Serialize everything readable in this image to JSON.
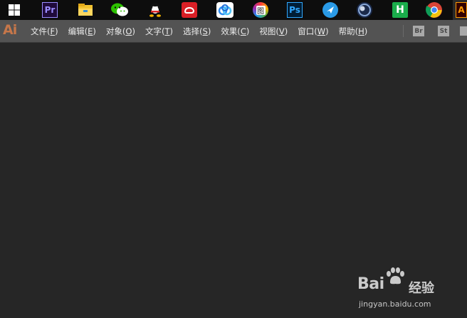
{
  "taskbar": {
    "icons": [
      {
        "name": "windows-start-icon",
        "label": ""
      },
      {
        "name": "premiere-icon",
        "label": "Pr",
        "color": "#9a8cff",
        "bg": "#1f0a3a"
      },
      {
        "name": "file-explorer-icon",
        "label": ""
      },
      {
        "name": "wechat-icon",
        "label": ""
      },
      {
        "name": "qq-icon",
        "label": ""
      },
      {
        "name": "creative-cloud-icon",
        "label": ""
      },
      {
        "name": "baidu-netdisk-icon",
        "label": ""
      },
      {
        "name": "image-viewer-icon",
        "label": "图"
      },
      {
        "name": "photoshop-icon",
        "label": "Ps",
        "color": "#31a8ff",
        "bg": "#001e36"
      },
      {
        "name": "feishu-icon",
        "label": ""
      },
      {
        "name": "cinema4d-icon",
        "label": ""
      },
      {
        "name": "hbuilder-icon",
        "label": "H",
        "color": "#ffffff",
        "bg": "#1aad4b"
      },
      {
        "name": "chrome-icon",
        "label": ""
      },
      {
        "name": "illustrator-icon",
        "label": "A",
        "color": "#ff9a00",
        "bg": "#330000"
      }
    ]
  },
  "menubar": {
    "app_logo": "Ai",
    "items": [
      {
        "label": "文件(",
        "key": "F",
        "tail": ")"
      },
      {
        "label": "编辑(",
        "key": "E",
        "tail": ")"
      },
      {
        "label": "对象(",
        "key": "O",
        "tail": ")"
      },
      {
        "label": "文字(",
        "key": "T",
        "tail": ")"
      },
      {
        "label": "选择(",
        "key": "S",
        "tail": ")"
      },
      {
        "label": "效果(",
        "key": "C",
        "tail": ")"
      },
      {
        "label": "视图(",
        "key": "V",
        "tail": ")"
      },
      {
        "label": "窗口(",
        "key": "W",
        "tail": ")"
      },
      {
        "label": "帮助(",
        "key": "H",
        "tail": ")"
      }
    ],
    "bridge_label": "Br",
    "stock_label": "St"
  },
  "watermark": {
    "brand": "Bai",
    "brand_suffix": "经验",
    "url": "jingyan.baidu.com"
  },
  "colors": {
    "workspace": "#262626",
    "menubar": "#535353",
    "taskbar": "#0d0d0d",
    "ai_logo": "#c6774a"
  }
}
